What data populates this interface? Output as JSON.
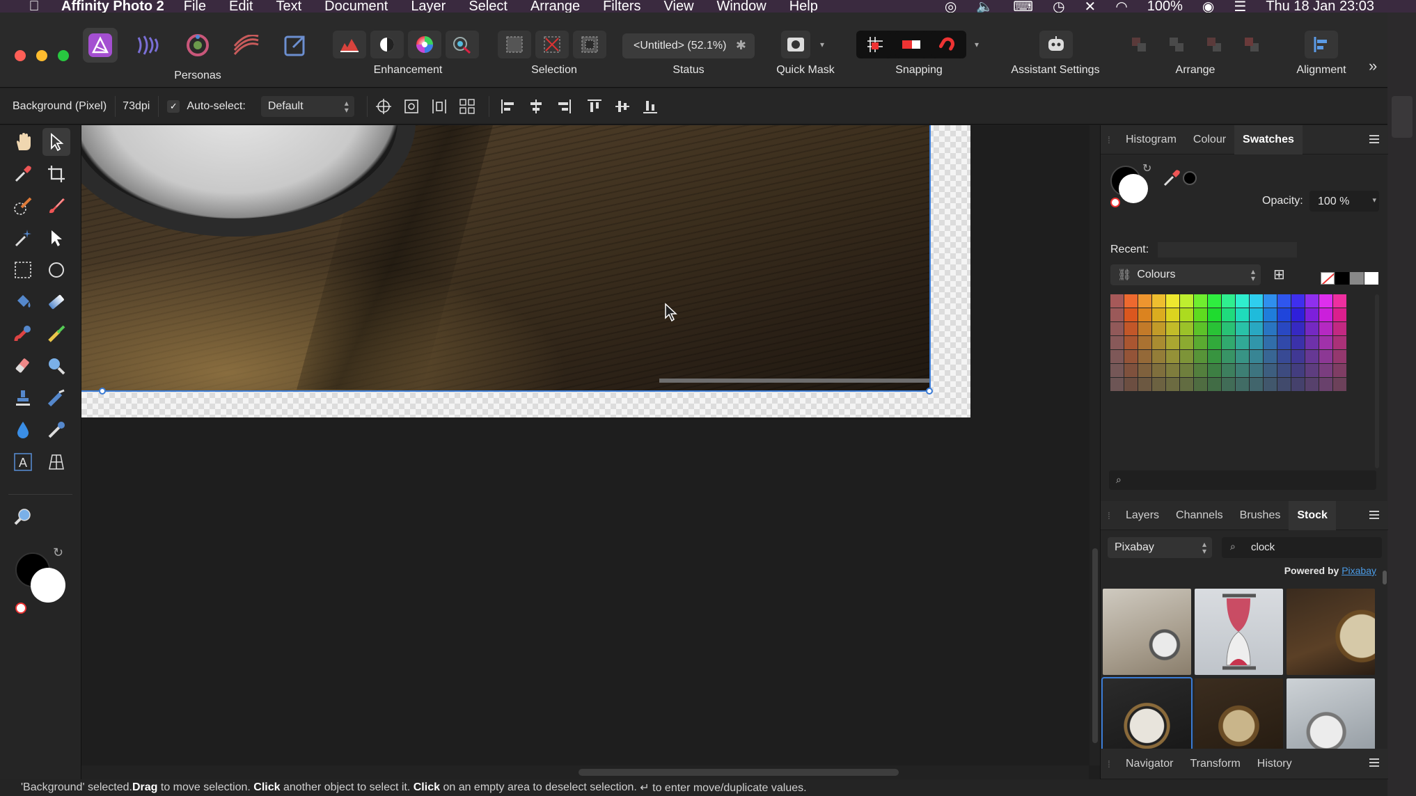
{
  "menubar": {
    "app_name": "Affinity Photo 2",
    "items": [
      "File",
      "Edit",
      "Text",
      "Document",
      "Layer",
      "Select",
      "Arrange",
      "Filters",
      "View",
      "Window",
      "Help"
    ],
    "battery": "100%",
    "datetime": "Thu 18 Jan  23:03"
  },
  "toolbar": {
    "personas_label": "Personas",
    "enhancement_label": "Enhancement",
    "selection_label": "Selection",
    "status_label": "Status",
    "status_value": "<Untitled> (52.1%)",
    "quick_mask_label": "Quick Mask",
    "snapping_label": "Snapping",
    "assistant_label": "Assistant Settings",
    "arrange_label": "Arrange",
    "alignment_label": "Alignment",
    "overflow": "»"
  },
  "context": {
    "layer_name": "Background (Pixel)",
    "dpi": "73dpi",
    "auto_select_label": "Auto-select:",
    "auto_select_value": "Default"
  },
  "swatches_panel": {
    "tabs": [
      "Histogram",
      "Colour",
      "Swatches"
    ],
    "active_tab": "Swatches",
    "opacity_label": "Opacity:",
    "opacity_value": "100 %",
    "recent_label": "Recent:",
    "palette": "Colours",
    "search_placeholder": ""
  },
  "stock_panel": {
    "tabs": [
      "Layers",
      "Channels",
      "Brushes",
      "Stock"
    ],
    "active_tab": "Stock",
    "provider": "Pixabay",
    "search_value": "clock",
    "powered_by": "Powered by",
    "powered_link": "Pixabay"
  },
  "bottom_panel": {
    "tabs": [
      "Navigator",
      "Transform",
      "History"
    ]
  },
  "statusbar": {
    "p1": "'Background' selected. ",
    "b1": "Drag",
    "p2": " to move selection. ",
    "b2": "Click",
    "p3": " another object to select it. ",
    "b3": "Click",
    "p4": " on an empty area to deselect selection. ",
    "p5": "↵ to enter move/duplicate values."
  },
  "colors": {
    "accent": "#3a7bd5",
    "affinity_purple": "#9c4dcc",
    "panel_bg": "#262626"
  }
}
